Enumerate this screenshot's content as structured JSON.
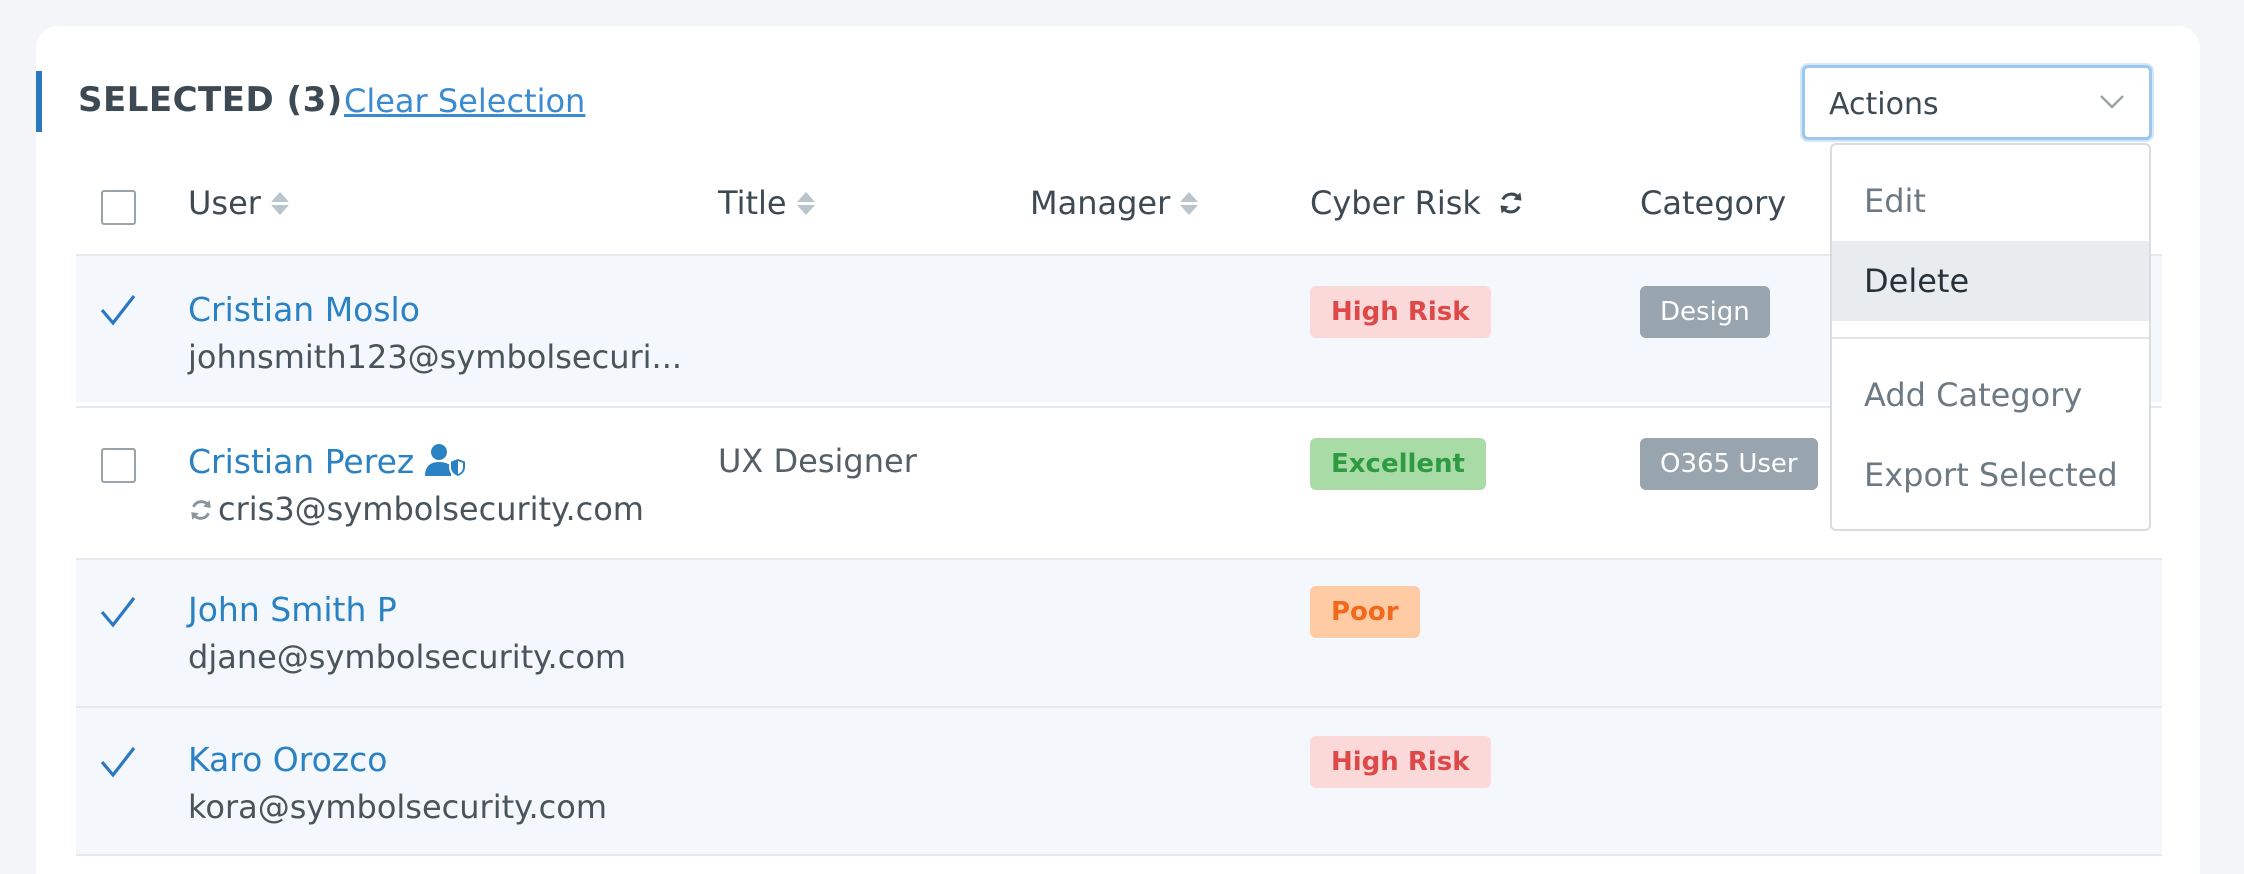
{
  "selection": {
    "label": "SELECTED (3)",
    "clear_label": "Clear Selection"
  },
  "actions": {
    "label": "Actions",
    "menu": [
      {
        "label": "Edit"
      },
      {
        "label": "Delete"
      },
      {
        "label": "Add Category"
      },
      {
        "label": "Export Selected"
      }
    ],
    "highlighted": "Delete"
  },
  "table": {
    "headers": {
      "user": "User",
      "title": "Title",
      "manager": "Manager",
      "cyber_risk": "Cyber Risk",
      "category": "Category"
    },
    "rows": [
      {
        "name": "Cristian Moslo",
        "email": "johnsmith123@symbolsecuri...",
        "title": "",
        "risk": "High Risk",
        "category": "Design",
        "selected": true
      },
      {
        "name": "Cristian Perez",
        "email": "cris3@symbolsecurity.com",
        "title": "UX Designer",
        "risk": "Excellent",
        "category": "O365 User",
        "selected": false
      },
      {
        "name": "John Smith P",
        "email": "djane@symbolsecurity.com",
        "title": "",
        "risk": "Poor",
        "category": "",
        "selected": true
      },
      {
        "name": "Karo Orozco",
        "email": "kora@symbolsecurity.com",
        "title": "",
        "risk": "High Risk",
        "category": "",
        "selected": true
      }
    ]
  },
  "colors": {
    "accent": "#2a78c2",
    "link": "#2a82c4",
    "high_risk_bg": "#fbd9d9",
    "high_risk_text": "#dd4848",
    "excellent_bg": "#a9dba6",
    "excellent_text": "#2e9a42",
    "poor_bg": "#ffcba4",
    "poor_text": "#f0691c",
    "category_bg": "#98a5ae"
  }
}
